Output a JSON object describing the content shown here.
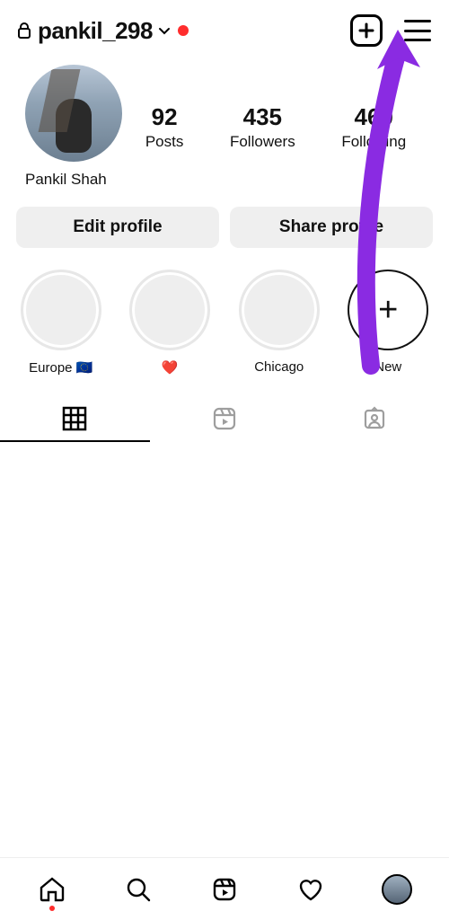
{
  "header": {
    "username": "pankil_298"
  },
  "profile": {
    "display_name": "Pankil Shah",
    "stats": {
      "posts": {
        "count": "92",
        "label": "Posts"
      },
      "followers": {
        "count": "435",
        "label": "Followers"
      },
      "following": {
        "count": "460",
        "label": "Following"
      }
    }
  },
  "buttons": {
    "edit_profile": "Edit profile",
    "share_profile": "Share profile"
  },
  "highlights": [
    {
      "label": "Europe 🇪🇺"
    },
    {
      "label": "❤️"
    },
    {
      "label": "Chicago"
    }
  ],
  "highlight_new_label": "New",
  "icons": {
    "plus": "+"
  }
}
